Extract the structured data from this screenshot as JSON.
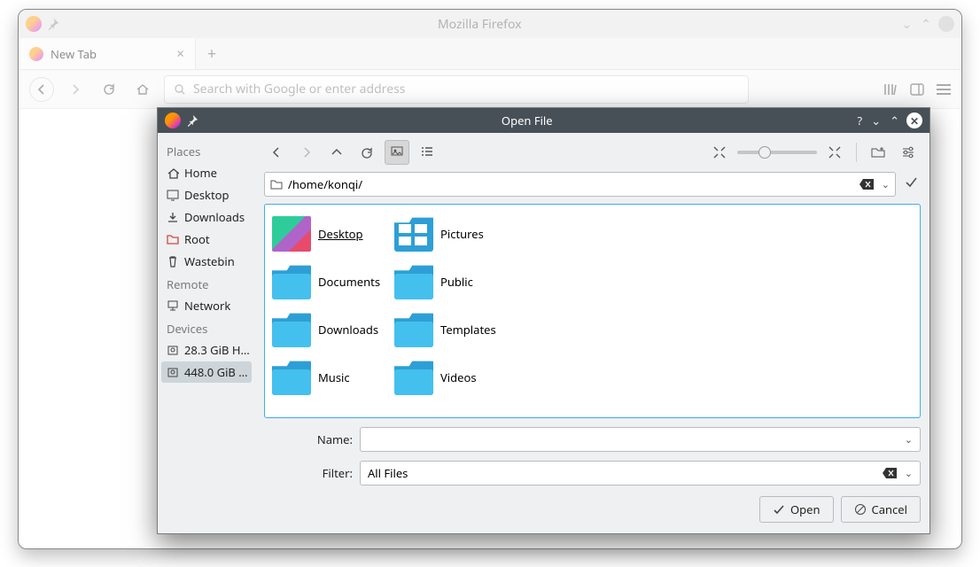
{
  "window": {
    "title": "Mozilla Firefox"
  },
  "tab": {
    "label": "New Tab"
  },
  "urlbar": {
    "placeholder": "Search with Google or enter address"
  },
  "dialog": {
    "title": "Open File",
    "path": "/home/konqi/",
    "name_label": "Name:",
    "name_value": "",
    "filter_label": "Filter:",
    "filter_value": "All Files",
    "open_label": "Open",
    "cancel_label": "Cancel"
  },
  "sidebar": {
    "sections": [
      {
        "header": "Places",
        "items": [
          {
            "label": "Home",
            "icon": "home"
          },
          {
            "label": "Desktop",
            "icon": "desktop"
          },
          {
            "label": "Downloads",
            "icon": "downloads"
          },
          {
            "label": "Root",
            "icon": "root"
          },
          {
            "label": "Wastebin",
            "icon": "trash"
          }
        ]
      },
      {
        "header": "Remote",
        "items": [
          {
            "label": "Network",
            "icon": "network"
          }
        ]
      },
      {
        "header": "Devices",
        "items": [
          {
            "label": "28.3 GiB H…",
            "icon": "drive"
          },
          {
            "label": "448.0 GiB …",
            "icon": "drive",
            "selected": true
          }
        ]
      }
    ]
  },
  "files": [
    {
      "label": "Desktop",
      "icon": "desktop-wall",
      "selected": true
    },
    {
      "label": "Pictures",
      "icon": "pictures"
    },
    {
      "label": "Documents",
      "icon": "folder"
    },
    {
      "label": "Public",
      "icon": "folder"
    },
    {
      "label": "Downloads",
      "icon": "folder"
    },
    {
      "label": "Templates",
      "icon": "folder"
    },
    {
      "label": "Music",
      "icon": "folder"
    },
    {
      "label": "Videos",
      "icon": "folder"
    }
  ]
}
